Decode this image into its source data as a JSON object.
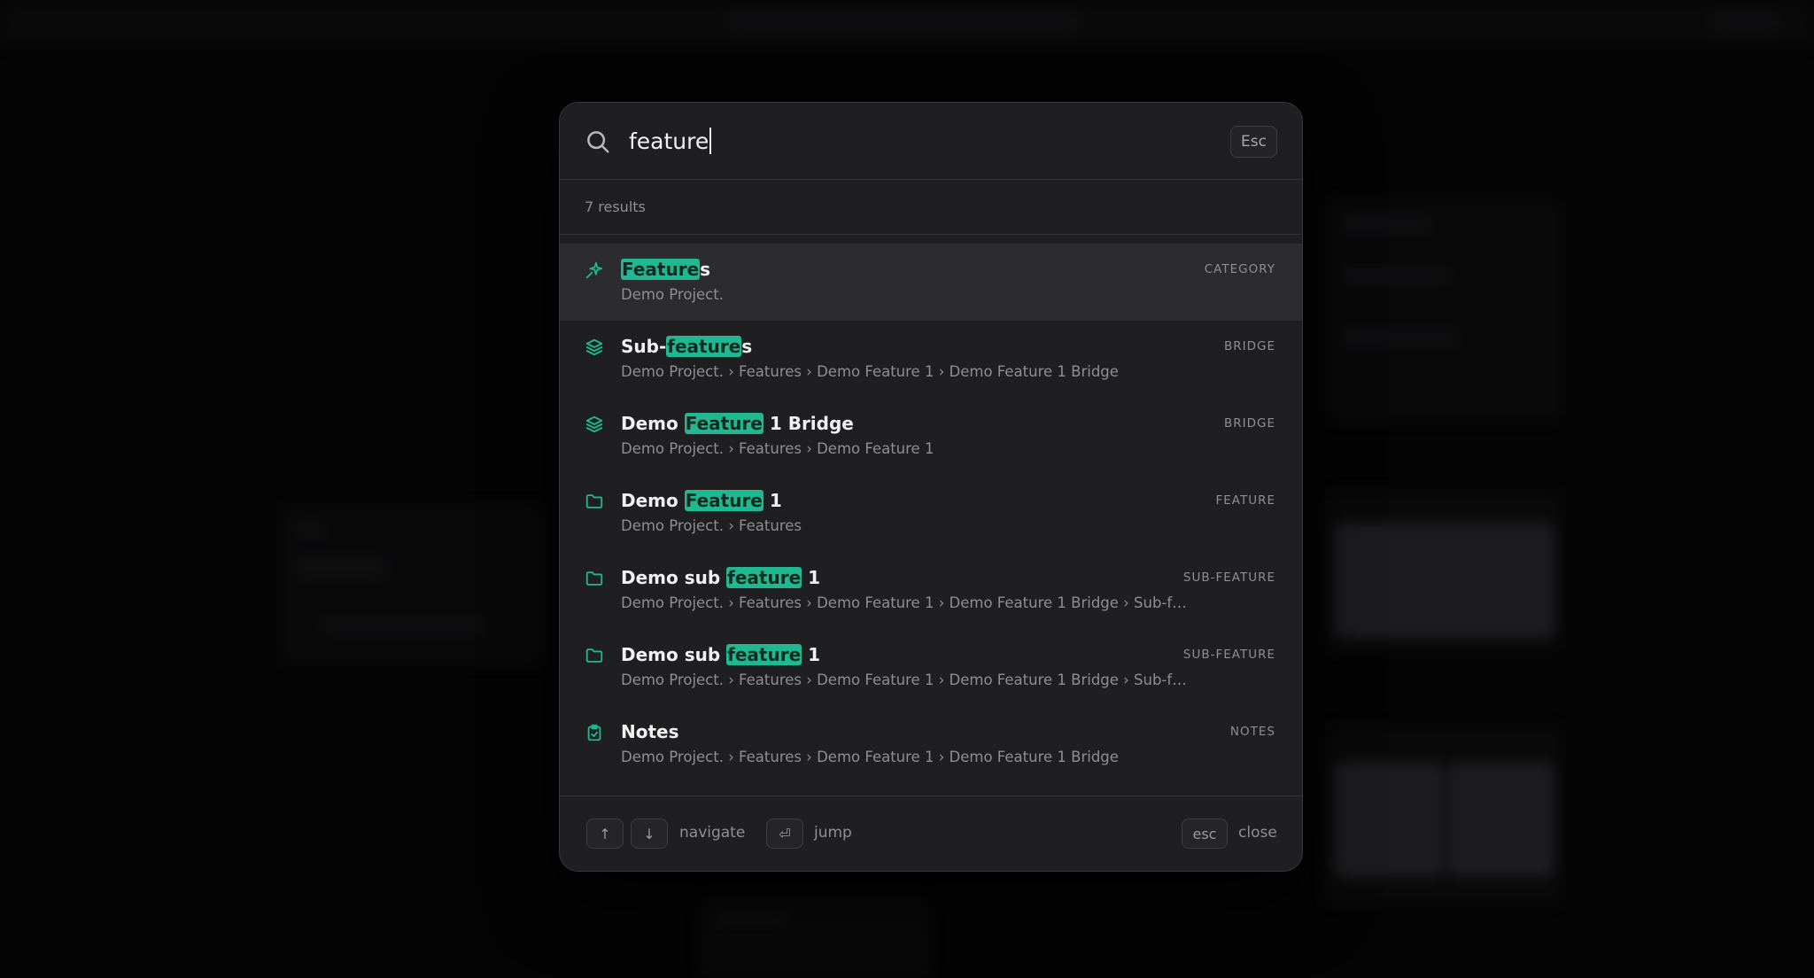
{
  "search": {
    "query": "feature",
    "esc_label": "Esc"
  },
  "results_count": "7 results",
  "results": [
    {
      "icon": "sparkle-icon",
      "title_pre": "",
      "title_hl": "Feature",
      "title_post": "s",
      "path": "Demo Project.",
      "type": "CATEGORY"
    },
    {
      "icon": "layers-icon",
      "title_pre": "Sub-",
      "title_hl": "feature",
      "title_post": "s",
      "path": "Demo Project. › Features › Demo Feature 1 › Demo Feature 1 Bridge",
      "type": "BRIDGE"
    },
    {
      "icon": "layers-icon",
      "title_pre": "Demo ",
      "title_hl": "Feature",
      "title_post": " 1 Bridge",
      "path": "Demo Project. › Features › Demo Feature 1",
      "type": "BRIDGE"
    },
    {
      "icon": "folder-icon",
      "title_pre": "Demo ",
      "title_hl": "Feature",
      "title_post": " 1",
      "path": "Demo Project. › Features",
      "type": "FEATURE"
    },
    {
      "icon": "folder-icon",
      "title_pre": "Demo sub ",
      "title_hl": "feature",
      "title_post": " 1",
      "path": "Demo Project. › Features › Demo Feature 1 › Demo Feature 1 Bridge › Sub-fe…",
      "type": "SUB-FEATURE"
    },
    {
      "icon": "folder-icon",
      "title_pre": "Demo sub ",
      "title_hl": "feature",
      "title_post": " 1",
      "path": "Demo Project. › Features › Demo Feature 1 › Demo Feature 1 Bridge › Sub-fe…",
      "type": "SUB-FEATURE"
    },
    {
      "icon": "clipboard-icon",
      "title_pre": "Notes",
      "title_hl": "",
      "title_post": "",
      "path": "Demo Project. › Features › Demo Feature 1 › Demo Feature 1 Bridge",
      "type": "NOTES"
    }
  ],
  "footer": {
    "up_key": "↑",
    "down_key": "↓",
    "navigate_label": "navigate",
    "enter_key": "⏎",
    "jump_label": "jump",
    "esc_key": "esc",
    "close_label": "close"
  },
  "colors": {
    "accent": "#1fb890",
    "panel": "#1f1f21",
    "selected_row": "#2c2c2f"
  }
}
